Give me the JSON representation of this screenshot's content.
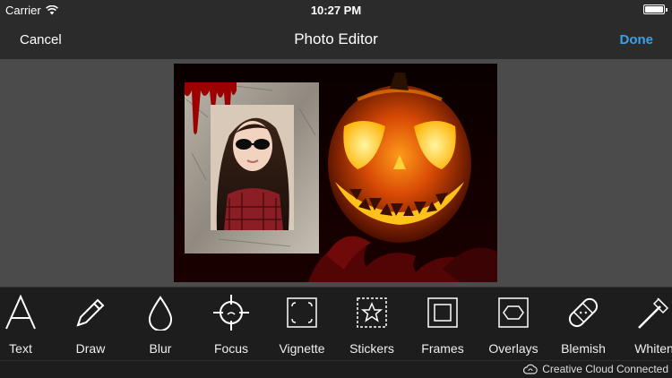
{
  "status": {
    "carrier": "Carrier",
    "time": "10:27 PM",
    "battery_level": 1.0
  },
  "nav": {
    "cancel": "Cancel",
    "title": "Photo Editor",
    "done": "Done"
  },
  "tools": [
    {
      "label": "Text",
      "icon": "text-icon"
    },
    {
      "label": "Draw",
      "icon": "pencil-icon"
    },
    {
      "label": "Blur",
      "icon": "droplet-icon"
    },
    {
      "label": "Focus",
      "icon": "crosshair-icon"
    },
    {
      "label": "Vignette",
      "icon": "vignette-icon"
    },
    {
      "label": "Stickers",
      "icon": "star-sticker-icon"
    },
    {
      "label": "Frames",
      "icon": "frame-icon"
    },
    {
      "label": "Overlays",
      "icon": "hexagon-icon"
    },
    {
      "label": "Blemish",
      "icon": "bandage-icon"
    },
    {
      "label": "Whiten",
      "icon": "brush-icon"
    }
  ],
  "footer": {
    "text": "Creative Cloud Connected"
  },
  "colors": {
    "accent": "#3aa1e8",
    "toolbar": "#1d1d1d",
    "canvas": "#4b4b4b"
  }
}
